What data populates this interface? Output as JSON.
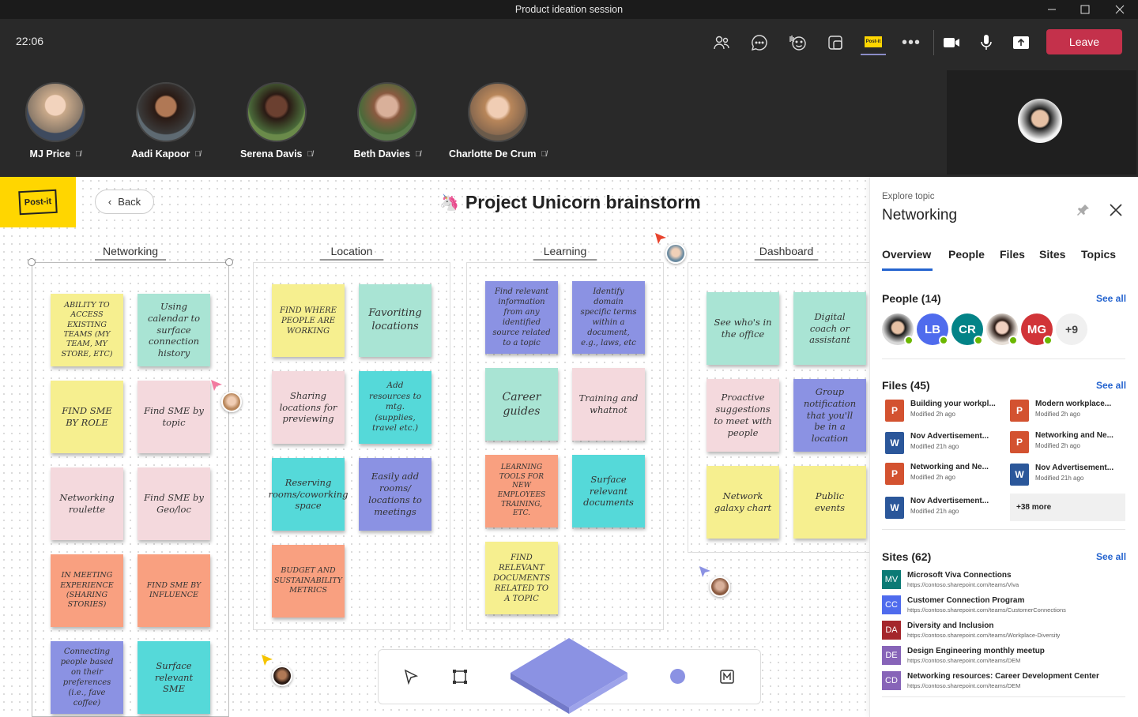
{
  "window": {
    "title": "Product ideation session"
  },
  "toolbar": {
    "time": "22:06",
    "leave_label": "Leave"
  },
  "participants": [
    {
      "name": "MJ Price",
      "color": "#c9a98a"
    },
    {
      "name": "Aadi Kapoor",
      "color": "#8a5a3c"
    },
    {
      "name": "Serena Davis",
      "color": "#5a3a2a"
    },
    {
      "name": "Beth Davies",
      "color": "#a67c64"
    },
    {
      "name": "Charlotte De Crum",
      "color": "#c7a080"
    }
  ],
  "board": {
    "back_label": "Back",
    "title": "Project Unicorn brainstorm",
    "logo_text": "Post-it",
    "columns": [
      {
        "title": "Networking",
        "notes": [
          {
            "text": "ABILITY TO ACCESS EXISTING TEAMS (MY TEAM, MY STORE, ETC)",
            "color": "yellow"
          },
          {
            "text": "Using calendar to surface connection history",
            "color": "mint"
          },
          {
            "text": "FIND SME BY ROLE",
            "color": "yellow"
          },
          {
            "text": "Find SME by topic",
            "color": "pink"
          },
          {
            "text": "Networking roulette",
            "color": "pink"
          },
          {
            "text": "Find SME by Geo/loc",
            "color": "pink"
          },
          {
            "text": "IN MEETING EXPERIENCE (SHARING STORIES)",
            "color": "orange"
          },
          {
            "text": "FIND SME BY INFLUENCE",
            "color": "orange"
          },
          {
            "text": "Connecting people based on their preferences (i.e., fave coffee)",
            "color": "purple"
          },
          {
            "text": "Surface relevant SME",
            "color": "cyan"
          }
        ]
      },
      {
        "title": "Location",
        "notes": [
          {
            "text": "FIND WHERE PEOPLE ARE WORKING",
            "color": "yellow"
          },
          {
            "text": "Favoriting locations",
            "color": "mint"
          },
          {
            "text": "Sharing locations for previewing",
            "color": "pink"
          },
          {
            "text": "Add resources to mtg. (supplies, travel etc.)",
            "color": "cyan"
          },
          {
            "text": "Reserving rooms/coworking space",
            "color": "cyan"
          },
          {
            "text": "Easily add rooms/ locations to meetings",
            "color": "purple"
          },
          {
            "text": "BUDGET AND SUSTAINABILITY METRICS",
            "color": "orange"
          }
        ]
      },
      {
        "title": "Learning",
        "notes": [
          {
            "text": "Find relevant information from any identified source related to a topic",
            "color": "purple"
          },
          {
            "text": "Identify domain specific terms within a document, e.g., laws, etc",
            "color": "purple"
          },
          {
            "text": "Career guides",
            "color": "mint"
          },
          {
            "text": "Training and whatnot",
            "color": "pink"
          },
          {
            "text": "LEARNING TOOLS FOR NEW EMPLOYEES TRAINING, ETC.",
            "color": "orange"
          },
          {
            "text": "Surface relevant documents",
            "color": "cyan"
          },
          {
            "text": "FIND RELEVANT DOCUMENTS RELATED TO A TOPIC",
            "color": "yellow"
          }
        ]
      },
      {
        "title": "Dashboard",
        "notes": [
          {
            "text": "See who's in the office",
            "color": "mint"
          },
          {
            "text": "Digital coach or assistant",
            "color": "mint"
          },
          {
            "text": "Proactive suggestions to meet with people",
            "color": "pink"
          },
          {
            "text": "Group notification that you'll be in a location",
            "color": "purple"
          },
          {
            "text": "Network galaxy chart",
            "color": "yellow"
          },
          {
            "text": "Public events",
            "color": "yellow"
          }
        ]
      }
    ]
  },
  "panel": {
    "eyebrow": "Explore topic",
    "topic": "Networking",
    "tabs": [
      "Overview",
      "People",
      "Files",
      "Sites",
      "Topics"
    ],
    "people": {
      "heading": "People (14)",
      "see_all": "See all",
      "avatars": [
        {
          "initials": "",
          "color": "#6b5a50"
        },
        {
          "initials": "LB",
          "color": "#4f6bed"
        },
        {
          "initials": "CR",
          "color": "#038387"
        },
        {
          "initials": "",
          "color": "#c8a89a"
        },
        {
          "initials": "MG",
          "color": "#d13438"
        }
      ],
      "more": "+9"
    },
    "files": {
      "heading": "Files (45)",
      "see_all": "See all",
      "items": [
        {
          "name": "Building your workpl...",
          "modified": "Modified 2h ago",
          "type": "P",
          "color": "#d35230"
        },
        {
          "name": "Modern workplace...",
          "modified": "Modified 2h ago",
          "type": "P",
          "color": "#d35230"
        },
        {
          "name": "Nov Advertisement...",
          "modified": "Modified 21h ago",
          "type": "W",
          "color": "#2b579a"
        },
        {
          "name": "Networking and Ne...",
          "modified": "Modified 2h ago",
          "type": "P",
          "color": "#d35230"
        },
        {
          "name": "Networking and Ne...",
          "modified": "Modified 2h ago",
          "type": "P",
          "color": "#d35230"
        },
        {
          "name": "Nov Advertisement...",
          "modified": "Modified 21h ago",
          "type": "W",
          "color": "#2b579a"
        },
        {
          "name": "Nov Advertisement...",
          "modified": "Modified 21h ago",
          "type": "W",
          "color": "#2b579a"
        }
      ],
      "more": "+38 more"
    },
    "sites": {
      "heading": "Sites (62)",
      "see_all": "See all",
      "items": [
        {
          "abbr": "MV",
          "color": "#0b7a75",
          "name": "Microsoft Viva Connections",
          "url": "https://contoso.sharepoint.com/teams/Viva"
        },
        {
          "abbr": "CC",
          "color": "#4f6bed",
          "name": "Customer Connection Program",
          "url": "https://contoso.sharepoint.com/teams/CustomerConnections"
        },
        {
          "abbr": "DA",
          "color": "#a4262c",
          "name": "Diversity and Inclusion",
          "url": "https://contoso.sharepoint.com/teams/Workplace-Diversity"
        },
        {
          "abbr": "DE",
          "color": "#8764b8",
          "name": "Design Engineering monthly meetup",
          "url": "https://contoso.sharepoint.com/teams/DEM"
        },
        {
          "abbr": "CD",
          "color": "#8764b8",
          "name": "Networking resources: Career Development Center",
          "url": "https://contoso.sharepoint.com/teams/DEM"
        }
      ]
    }
  }
}
